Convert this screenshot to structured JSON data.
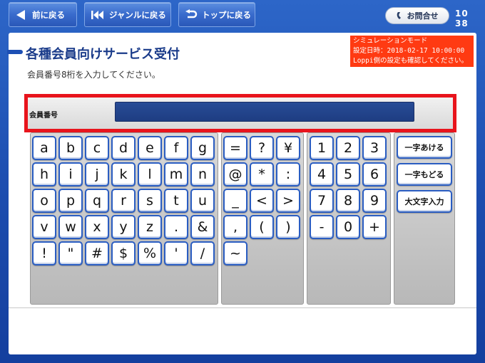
{
  "nav": {
    "back_label": "前に戻る",
    "genre_label": "ジャンルに戻る",
    "top_label": "トップに戻る",
    "contact_label": "お問合せ",
    "clock": "10 38"
  },
  "simulation": {
    "line1": "シミュレーションモード",
    "line2": "設定日時：2018-02-17 10:00:00",
    "line3": "Loppi側の設定も確認してください。"
  },
  "page": {
    "title": "各種会員向けサービス受付",
    "subtitle": "会員番号8桁を入力してください。"
  },
  "member": {
    "label": "会員番号",
    "value": ""
  },
  "keyboard": {
    "alpha": [
      [
        "a",
        "b",
        "c",
        "d",
        "e",
        "f",
        "g"
      ],
      [
        "h",
        "i",
        "j",
        "k",
        "l",
        "m",
        "n"
      ],
      [
        "o",
        "p",
        "q",
        "r",
        "s",
        "t",
        "u"
      ],
      [
        "v",
        "w",
        "x",
        "y",
        "z",
        ".",
        "&"
      ],
      [
        "!",
        "\"",
        "#",
        "$",
        "%",
        "'",
        "/"
      ]
    ],
    "symbols": [
      [
        "=",
        "?",
        "¥"
      ],
      [
        "@",
        "*",
        ":"
      ],
      [
        "_",
        "<",
        ">"
      ],
      [
        ",",
        "(",
        ")"
      ],
      [
        "~"
      ]
    ],
    "numbers": [
      [
        "1",
        "2",
        "3"
      ],
      [
        "4",
        "5",
        "6"
      ],
      [
        "7",
        "8",
        "9"
      ],
      [
        "-",
        "0",
        "+"
      ]
    ],
    "functions": [
      "一字あける",
      "一字もどる",
      "大文字入力"
    ]
  },
  "colors": {
    "accent": "#2a5dc2",
    "highlight": "#e8141c",
    "sim_bg": "#ff3a12"
  }
}
